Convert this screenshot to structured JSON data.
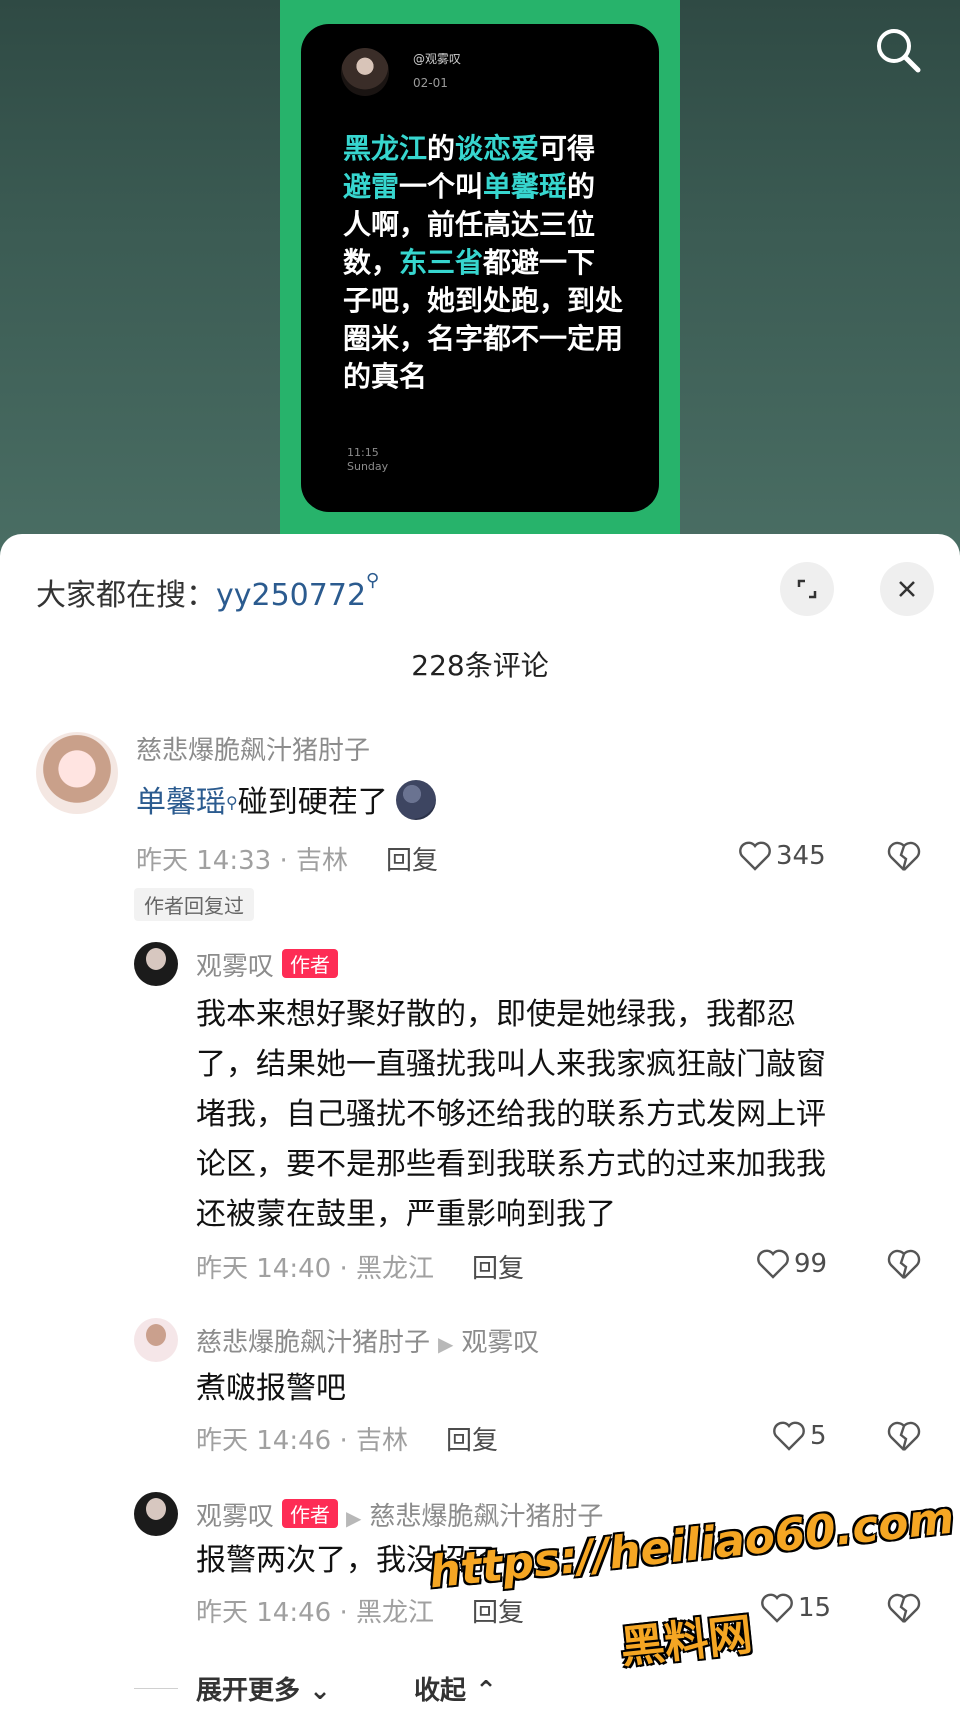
{
  "video_card": {
    "handle": "@观雾叹",
    "date": "02-01",
    "text_segments": [
      {
        "t": "黑龙江",
        "hl": true
      },
      {
        "t": "的",
        "hl": false
      },
      {
        "t": "谈恋爱",
        "hl": true
      },
      {
        "t": "可得",
        "hl": false
      },
      {
        "t": "避雷",
        "hl": true
      },
      {
        "t": "一个叫",
        "hl": false
      },
      {
        "t": "单馨瑶",
        "hl": true
      },
      {
        "t": "的人啊，前任高达三位数，",
        "hl": false
      },
      {
        "t": "东三省",
        "hl": true
      },
      {
        "t": "都避一下子吧，她到处跑，到处圈米，名字都不一定用的真名",
        "hl": false
      }
    ],
    "time": "11:15",
    "day": "Sunday"
  },
  "sheet": {
    "search_prefix": "大家都在搜：",
    "search_keyword": "yy250772",
    "count_label": "228条评论"
  },
  "comments": [
    {
      "user": "慈悲爆脆飙汁猪肘子",
      "kw": "单馨瑶",
      "text": "碰到硬茬了",
      "meta": "昨天 14:33 · 吉林",
      "reply_label": "回复",
      "likes": "345",
      "tag": "作者回复过"
    },
    {
      "user": "观雾叹",
      "badge": "作者",
      "text_lines": [
        "我本来想好聚好散的，即使是她绿我，我都忍",
        "了，结果她一直骚扰我叫人来我家疯狂敲门敲窗",
        "堵我，自己骚扰不够还给我的联系方式发网上评",
        "论区，要不是那些看到我联系方式的过来加我我",
        "还被蒙在鼓里，严重影响到我了"
      ],
      "meta": "昨天 14:40 · 黑龙江",
      "reply_label": "回复",
      "likes": "99"
    },
    {
      "user": "慈悲爆脆飙汁猪肘子",
      "reply_to": "观雾叹",
      "text": "煮啵报警吧",
      "meta": "昨天 14:46 · 吉林",
      "reply_label": "回复",
      "likes": "5"
    },
    {
      "user": "观雾叹",
      "badge": "作者",
      "reply_to": "慈悲爆脆飙汁猪肘子",
      "text": "报警两次了，我没招了",
      "meta": "昨天 14:46 · 黑龙江",
      "reply_label": "回复",
      "likes": "15"
    }
  ],
  "footer": {
    "expand_more": "展开更多",
    "collapse": "收起"
  },
  "watermark": {
    "url": "https://heiliao60.com",
    "name": "黑料网"
  }
}
